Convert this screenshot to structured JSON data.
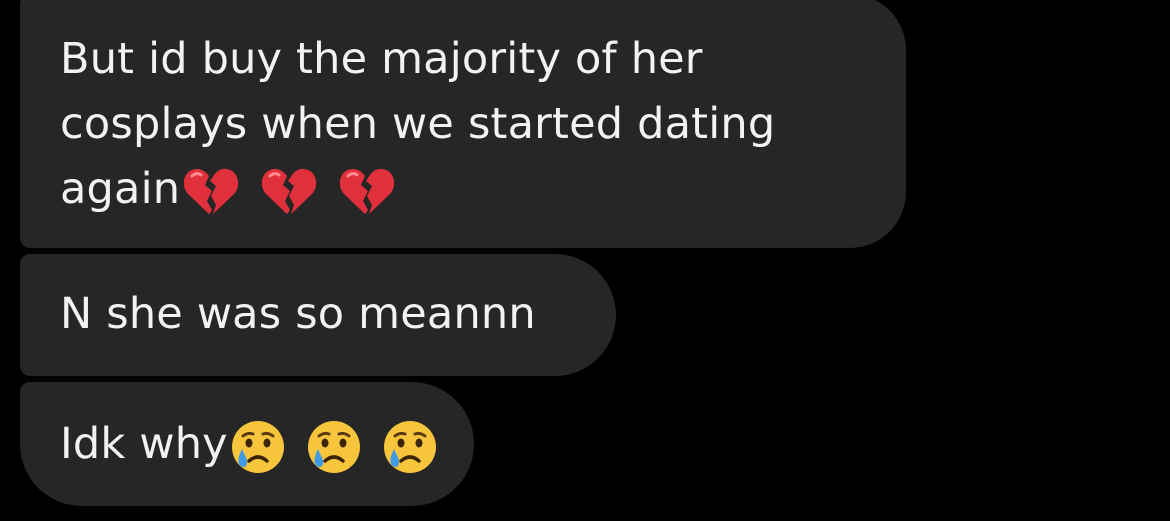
{
  "messages": [
    {
      "lines": [
        "But id buy the majority of her",
        "cosplays when we started dating",
        "again"
      ],
      "emojis": [
        "broken-heart-icon",
        "broken-heart-icon",
        "broken-heart-icon"
      ]
    },
    {
      "lines": [
        "N she was so meannn"
      ],
      "emojis": []
    },
    {
      "lines": [
        "Idk why"
      ],
      "emojis": [
        "crying-face-icon",
        "crying-face-icon",
        "crying-face-icon"
      ]
    }
  ],
  "colors": {
    "background": "#000000",
    "bubble": "#262626",
    "text": "#f2f2f2",
    "broken_heart": "#e0303c",
    "crying_face": "#f7c53b",
    "tear": "#3f9be6"
  }
}
